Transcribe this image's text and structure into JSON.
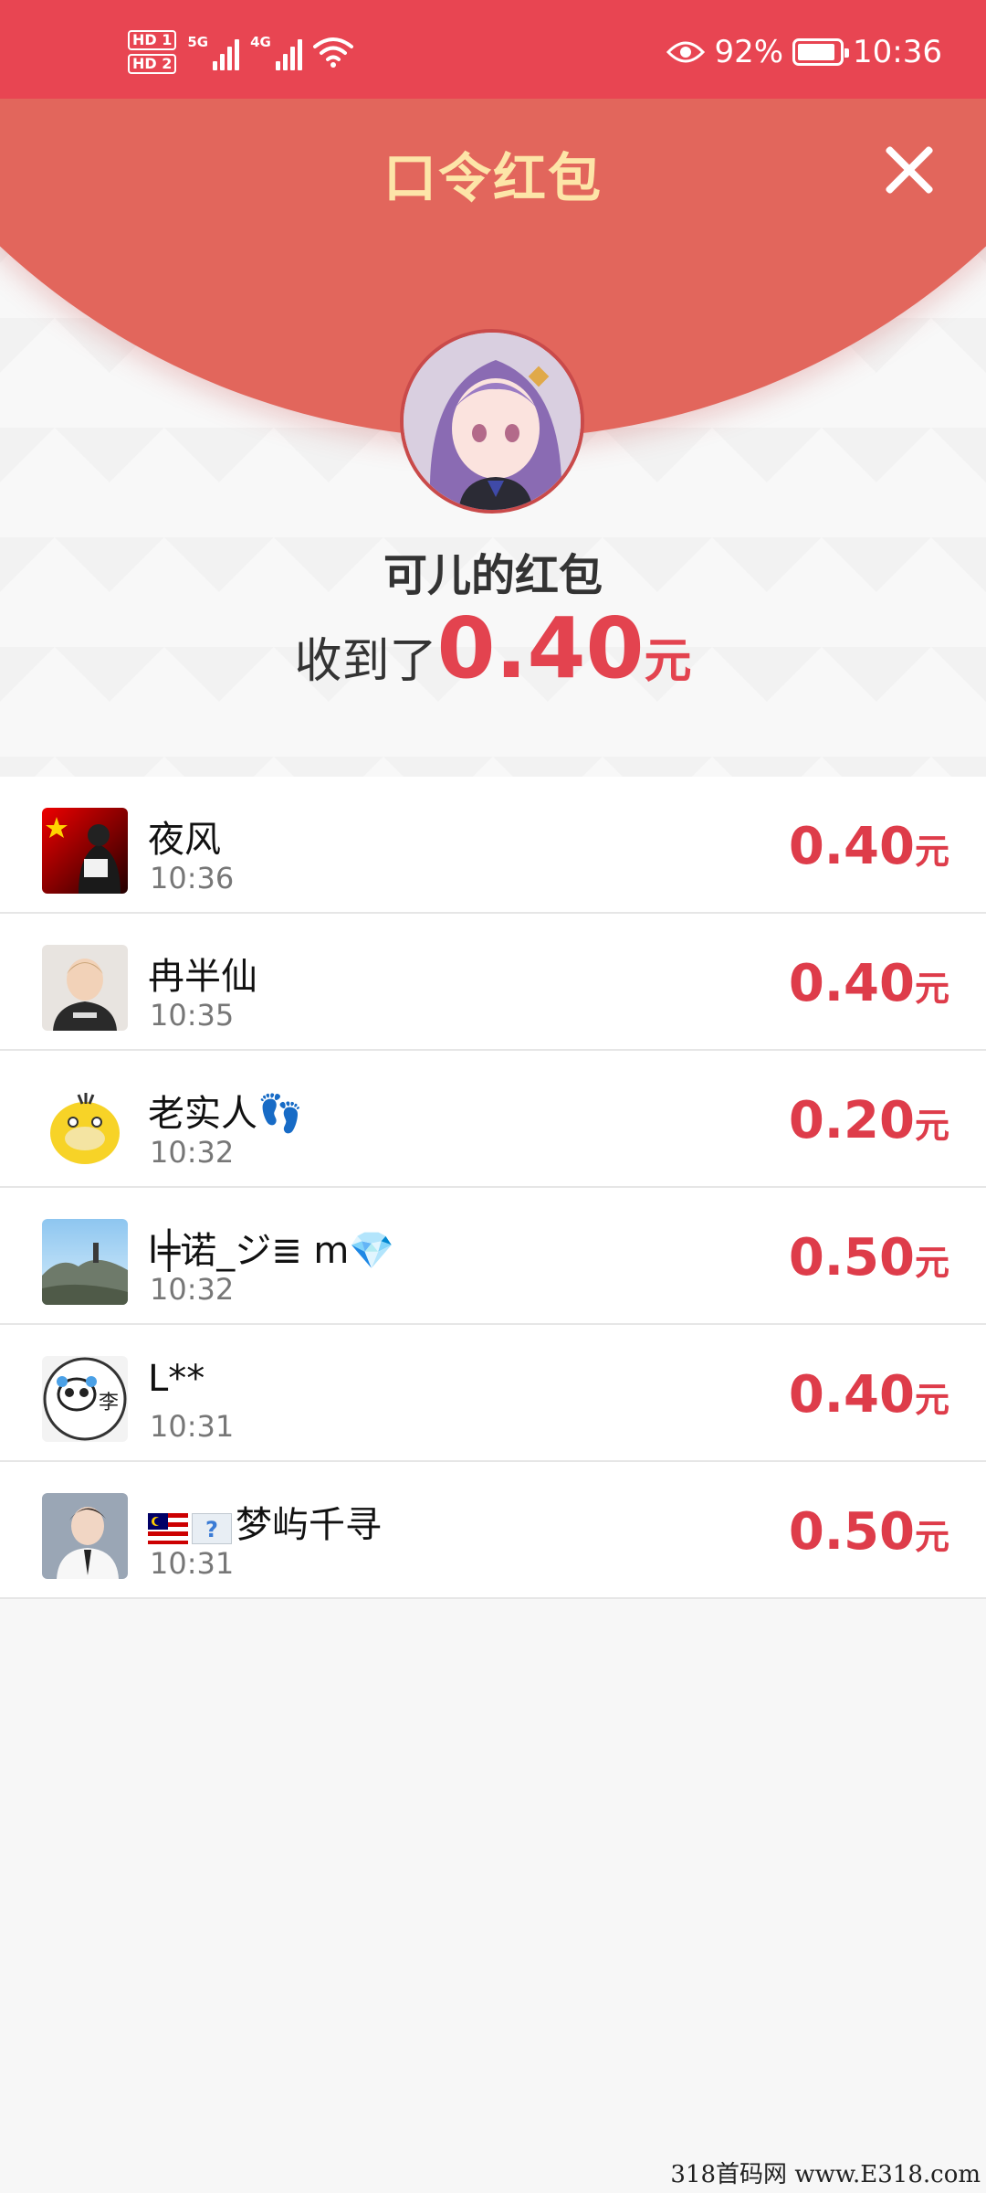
{
  "status_bar": {
    "hd1": "HD 1",
    "hd2": "HD 2",
    "net1": "5G",
    "net2": "4G",
    "battery_percent": "92%",
    "battery_level": 0.92,
    "time": "10:36"
  },
  "header": {
    "title": "口令红包",
    "sender": "可儿的红包",
    "received_prefix": "收到了",
    "received_amount": "0.40",
    "received_unit": "元"
  },
  "records": [
    {
      "name": "夜风",
      "time": "10:36",
      "amount": "0.40",
      "unit": "元"
    },
    {
      "name": "冉半仙",
      "time": "10:35",
      "amount": "0.40",
      "unit": "元"
    },
    {
      "name": "老实人👣",
      "time": "10:32",
      "amount": "0.20",
      "unit": "元"
    },
    {
      "name": "l╪诺_ジ≣ m",
      "name_suffix": "💎",
      "time": "10:32",
      "amount": "0.50",
      "unit": "元"
    },
    {
      "name": "L**",
      "time": "10:31",
      "amount": "0.40",
      "unit": "元"
    },
    {
      "name": "梦屿千寻",
      "time": "10:31",
      "amount": "0.50",
      "unit": "元"
    }
  ],
  "watermark": "318首码网 www.E318.com",
  "colors": {
    "status_bar": "#e84552",
    "header_arc": "#e2665c",
    "title": "#fde5a8",
    "amount": "#de3c4a"
  }
}
